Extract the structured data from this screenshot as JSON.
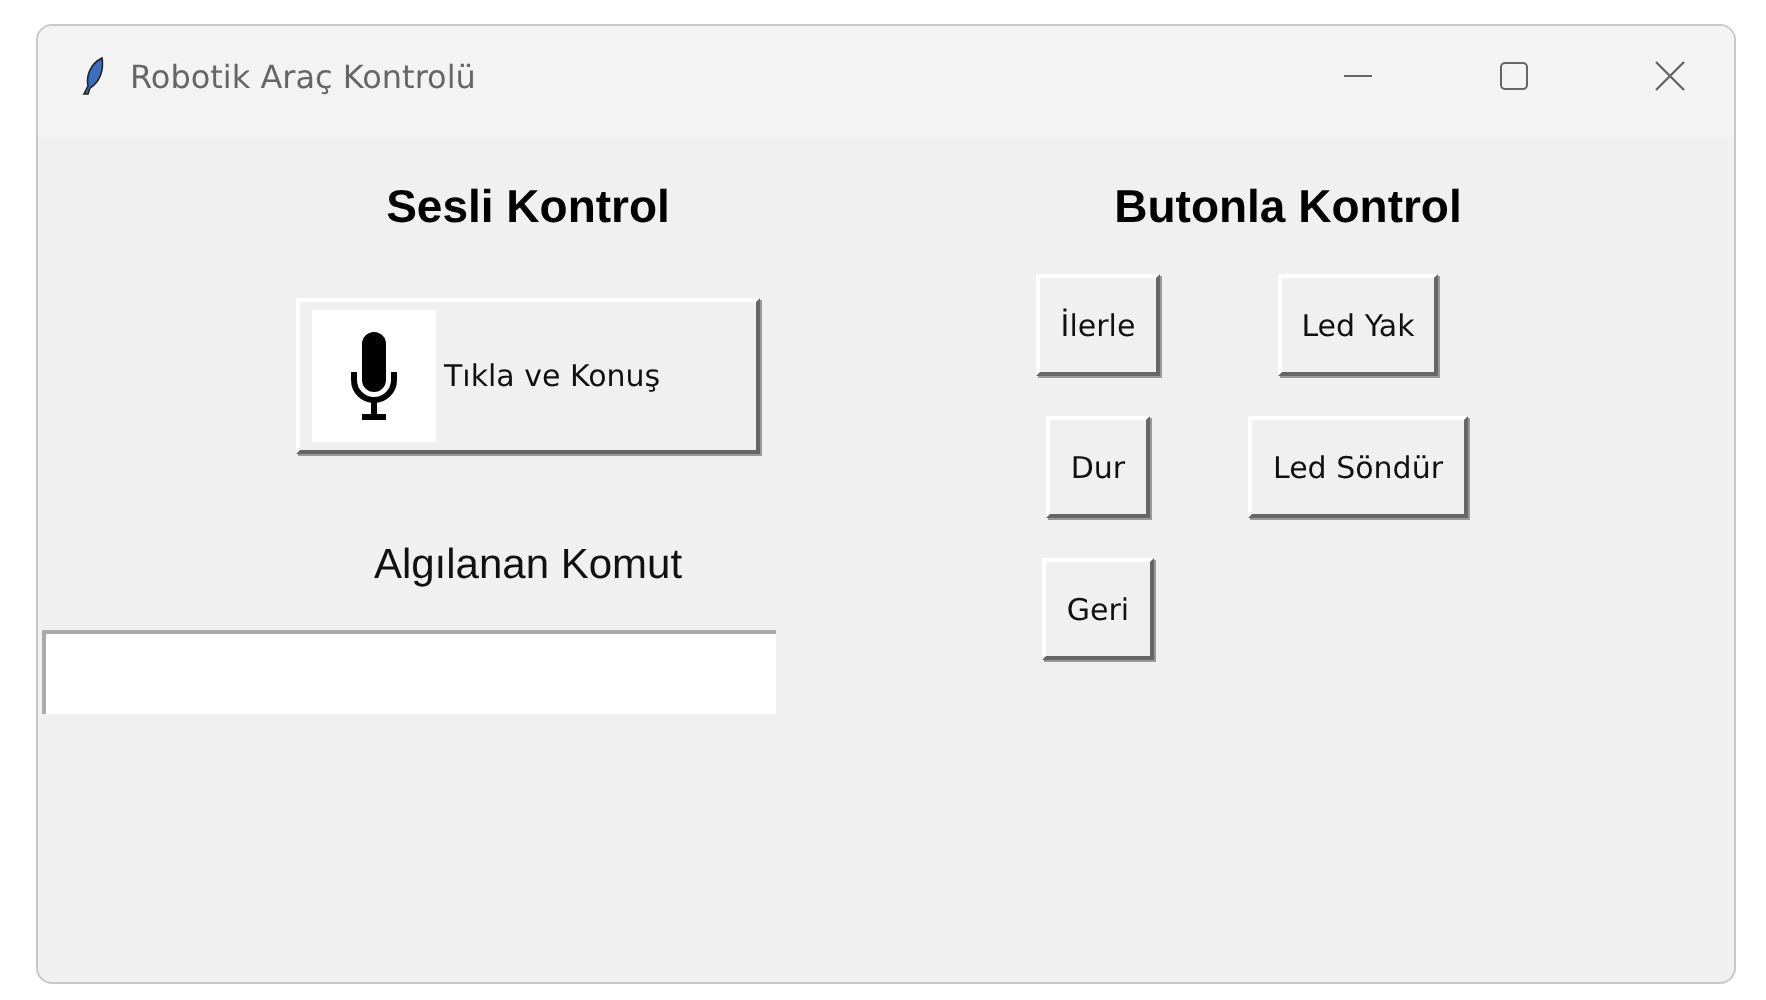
{
  "window": {
    "title": "Robotik Araç Kontrolü"
  },
  "voice": {
    "heading": "Sesli Kontrol",
    "button": "Tıkla ve Konuş",
    "label": "Algılanan Komut"
  },
  "manual": {
    "heading": "Butonla Kontrol",
    "buttons": [
      {
        "label": "İlerle"
      },
      {
        "label": "Led Yak"
      },
      {
        "label": "Dur"
      },
      {
        "label": "Led Söndür"
      },
      {
        "label": "Geri"
      }
    ]
  }
}
